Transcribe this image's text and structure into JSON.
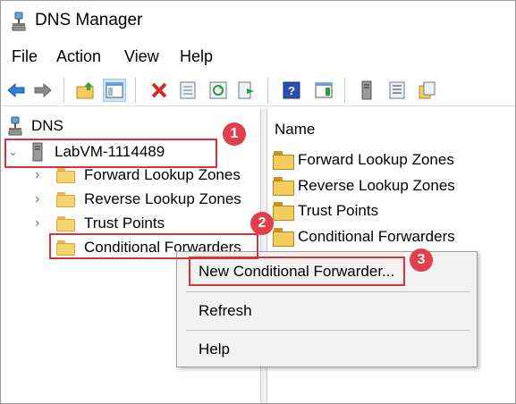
{
  "window": {
    "title": "DNS Manager"
  },
  "menu": [
    "File",
    "Action",
    "View",
    "Help"
  ],
  "toolbar": {
    "buttons": [
      {
        "icon": "back-arrow-icon"
      },
      {
        "icon": "forward-arrow-icon"
      },
      {
        "icon": "up-folder-icon"
      },
      {
        "icon": "show-hide-console-tree-icon",
        "active": true
      },
      {
        "icon": "delete-icon"
      },
      {
        "icon": "properties-icon"
      },
      {
        "icon": "refresh-icon"
      },
      {
        "icon": "export-list-icon"
      },
      {
        "icon": "help-icon"
      },
      {
        "icon": "action-pane-icon"
      },
      {
        "icon": "server-icon"
      },
      {
        "icon": "list-icon"
      },
      {
        "icon": "filter-icon"
      }
    ]
  },
  "tree": {
    "root": "DNS",
    "server": "LabVM-1114489",
    "children": [
      "Forward Lookup Zones",
      "Reverse Lookup Zones",
      "Trust Points",
      "Conditional Forwarders"
    ]
  },
  "list": {
    "header": "Name",
    "items": [
      "Forward Lookup Zones",
      "Reverse Lookup Zones",
      "Trust Points",
      "Conditional Forwarders"
    ]
  },
  "context_menu": {
    "items": [
      "New Conditional Forwarder...",
      "Refresh",
      "Help"
    ]
  },
  "badges": [
    "1",
    "2",
    "3"
  ],
  "colors": {
    "highlight": "#e0303c",
    "badge": "#e0404a",
    "folder": "#f5d470"
  }
}
